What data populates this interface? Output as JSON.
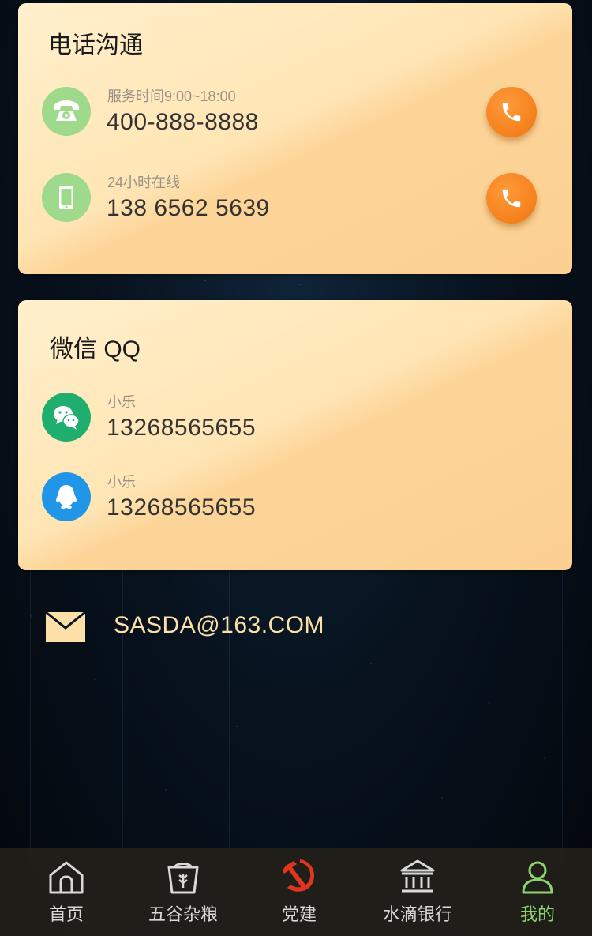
{
  "phone_card": {
    "title": "电话沟通",
    "rows": [
      {
        "caption": "服务时间9:00~18:00",
        "value": "400-888-8888",
        "icon": "telephone-icon"
      },
      {
        "caption": "24小时在线",
        "value": "138 6562 5639",
        "icon": "mobile-phone-icon"
      }
    ]
  },
  "social_card": {
    "title": "微信 QQ",
    "rows": [
      {
        "caption": "小乐",
        "value": "13268565655",
        "icon": "wechat-icon"
      },
      {
        "caption": "小乐",
        "value": "13268565655",
        "icon": "qq-icon"
      }
    ]
  },
  "email": {
    "address": "SASDA@163.COM",
    "icon": "mail-icon"
  },
  "tabbar": {
    "active": 4,
    "items": [
      {
        "label": "首页",
        "icon": "home-icon"
      },
      {
        "label": "五谷杂粮",
        "icon": "grain-basket-icon"
      },
      {
        "label": "党建",
        "icon": "party-emblem-icon"
      },
      {
        "label": "水滴银行",
        "icon": "bank-icon"
      },
      {
        "label": "我的",
        "icon": "user-icon"
      }
    ]
  },
  "colors": {
    "card_gradient_start": "#fff0cc",
    "card_gradient_end": "#fcd092",
    "call_button": "#f5801c",
    "email_text": "#fde0a8",
    "tab_active": "#8fd36f",
    "tab_inactive": "#d9d9d9",
    "wechat": "#1fae6e",
    "qq": "#2196e8",
    "phone_avatar": "#9fd98c"
  }
}
